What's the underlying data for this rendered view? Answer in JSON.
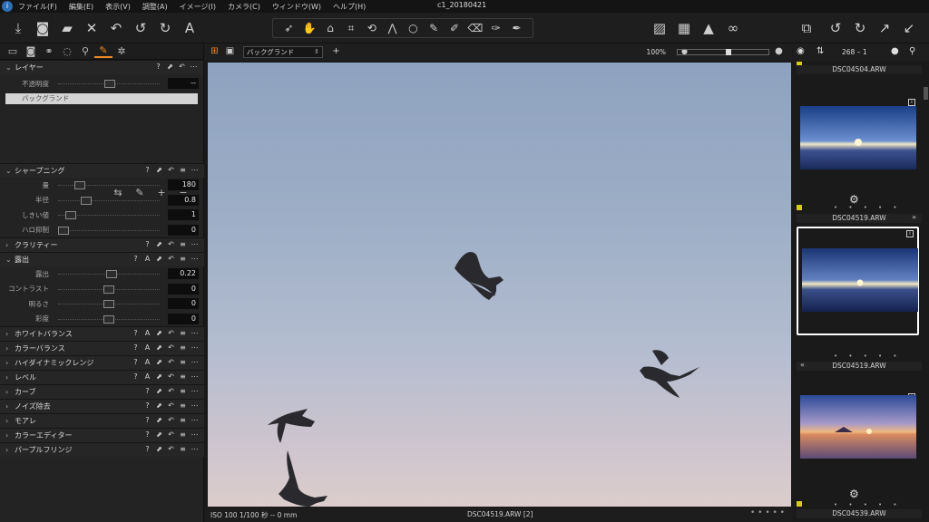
{
  "app": {
    "title": "c1_20180421",
    "icon_glyph": "i"
  },
  "menu": [
    "ファイル(F)",
    "編集(E)",
    "表示(V)",
    "調整(A)",
    "イメージ(I)",
    "カメラ(C)",
    "ウィンドウ(W)",
    "ヘルプ(H)"
  ],
  "toolbar": {
    "left_icons": [
      "import-icon",
      "camera-icon",
      "folder-export-icon",
      "delete-icon",
      "undo-rotate-icon",
      "undo-icon",
      "redo-icon",
      "text-icon"
    ],
    "tools": [
      "cursor-tool-icon",
      "pan-hand-icon",
      "loupe-icon",
      "crop-icon",
      "rotate-icon",
      "keystone-icon",
      "spot-icon",
      "brush-icon",
      "gradient-icon",
      "eraser-icon",
      "picker-icon",
      "color-picker-icon"
    ],
    "active_tool": 1,
    "right_icons": [
      "compare-icon",
      "grid-icon",
      "warning-icon",
      "glasses-icon",
      "copy-icon",
      "rotate-left-icon",
      "rotate-right-icon",
      "expand-icon",
      "collapse-icon"
    ]
  },
  "left_tabs": [
    "library-tab",
    "capture-tab",
    "color-tab",
    "lens-tab",
    "details-tab",
    "adjust-tab",
    "settings-tab"
  ],
  "left_active_tab": 5,
  "layer": {
    "title": "レイヤー",
    "opacity_label": "不透明度",
    "opacity_value": "--",
    "layer_name": "バックグランド"
  },
  "sharpening": {
    "title": "シャープニング",
    "rows": [
      {
        "label": "量",
        "value": "180",
        "pos": 0.18
      },
      {
        "label": "半径",
        "value": "0.8",
        "pos": 0.25
      },
      {
        "label": "しきい値",
        "value": "1",
        "pos": 0.08
      },
      {
        "label": "ハロ抑制",
        "value": "0",
        "pos": 0.0
      }
    ]
  },
  "clarity": {
    "title": "クラリティー"
  },
  "exposure": {
    "title": "露出",
    "rows": [
      {
        "label": "露出",
        "value": "0.22",
        "pos": 0.53
      },
      {
        "label": "コントラスト",
        "value": "0",
        "pos": 0.5
      },
      {
        "label": "明るさ",
        "value": "0",
        "pos": 0.5
      },
      {
        "label": "彩度",
        "value": "0",
        "pos": 0.5
      }
    ]
  },
  "sections": [
    "ホワイトバランス",
    "カラーバランス",
    "ハイダイナミックレンジ",
    "レベル",
    "カーブ",
    "ノイズ除去",
    "モアレ",
    "カラーエディター",
    "パープルフリンジ"
  ],
  "viewer": {
    "variant": "バックグランド",
    "zoom": "100%",
    "zoom_level": 0.55,
    "status_left": "ISO 100  1/100 秒  --  0 mm",
    "status_center": "DSC04519.ARW [2]",
    "status_right": "• • • • •"
  },
  "browser": {
    "count": "268 – 1",
    "captions": [
      "DSC04504.ARW",
      "DSC04519.ARW",
      "DSC04519.ARW",
      "DSC04539.ARW"
    ],
    "ratings": "• • • • •"
  },
  "colors": {
    "accent": "#f08a24",
    "color_tag": "#d4cc1a"
  }
}
